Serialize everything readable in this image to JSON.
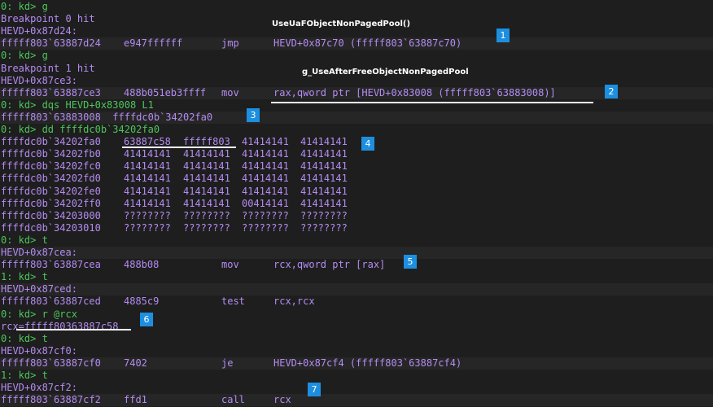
{
  "lines": [
    {
      "type": "prompt",
      "text": "0: kd> g"
    },
    {
      "type": "text",
      "text": "Breakpoint 0 hit"
    },
    {
      "type": "text",
      "text": "HEVD+0x87d24:"
    },
    {
      "type": "instr",
      "addr": "fffff803`63887d24",
      "bytes": "e947ffffff",
      "mnem": "jmp",
      "ops": "HEVD+0x87c70 (fffff803`63887c70)"
    },
    {
      "type": "prompt",
      "text": "0: kd> g"
    },
    {
      "type": "text",
      "text": "Breakpoint 1 hit"
    },
    {
      "type": "text",
      "text": "HEVD+0x87ce3:"
    },
    {
      "type": "instr",
      "addr": "fffff803`63887ce3",
      "bytes": "488b051eb3ffff",
      "mnem": "mov",
      "ops": "rax,qword ptr [HEVD+0x83008 (fffff803`63883008)]"
    },
    {
      "type": "prompt",
      "text": "0: kd> dqs HEVD+0x83008 L1"
    },
    {
      "type": "text",
      "text": "fffff803`63883008  ffffdc0b`34202fa0"
    },
    {
      "type": "prompt",
      "text": "0: kd> dd ffffdc0b`34202fa0"
    },
    {
      "type": "dump",
      "addr": "ffffdc0b`34202fa0",
      "d": [
        "63887c58",
        "fffff803",
        "41414141",
        "41414141"
      ]
    },
    {
      "type": "dump",
      "addr": "ffffdc0b`34202fb0",
      "d": [
        "41414141",
        "41414141",
        "41414141",
        "41414141"
      ]
    },
    {
      "type": "dump",
      "addr": "ffffdc0b`34202fc0",
      "d": [
        "41414141",
        "41414141",
        "41414141",
        "41414141"
      ]
    },
    {
      "type": "dump",
      "addr": "ffffdc0b`34202fd0",
      "d": [
        "41414141",
        "41414141",
        "41414141",
        "41414141"
      ]
    },
    {
      "type": "dump",
      "addr": "ffffdc0b`34202fe0",
      "d": [
        "41414141",
        "41414141",
        "41414141",
        "41414141"
      ]
    },
    {
      "type": "dump",
      "addr": "ffffdc0b`34202ff0",
      "d": [
        "41414141",
        "41414141",
        "00414141",
        "41414141"
      ]
    },
    {
      "type": "dump",
      "addr": "ffffdc0b`34203000",
      "d": [
        "????????",
        "????????",
        "????????",
        "????????"
      ]
    },
    {
      "type": "dump",
      "addr": "ffffdc0b`34203010",
      "d": [
        "????????",
        "????????",
        "????????",
        "????????"
      ]
    },
    {
      "type": "prompt",
      "text": "0: kd> t"
    },
    {
      "type": "text",
      "text": "HEVD+0x87cea:"
    },
    {
      "type": "instr",
      "addr": "fffff803`63887cea",
      "bytes": "488b08",
      "mnem": "mov",
      "ops": "rcx,qword ptr [rax]"
    },
    {
      "type": "prompt",
      "text": "1: kd> t"
    },
    {
      "type": "text",
      "text": "HEVD+0x87ced:"
    },
    {
      "type": "instr",
      "addr": "fffff803`63887ced",
      "bytes": "4885c9",
      "mnem": "test",
      "ops": "rcx,rcx"
    },
    {
      "type": "prompt",
      "text": "0: kd> r @rcx"
    },
    {
      "type": "text",
      "text": "rcx=fffff80363887c58"
    },
    {
      "type": "prompt",
      "text": "0: kd> t"
    },
    {
      "type": "text",
      "text": "HEVD+0x87cf0:"
    },
    {
      "type": "instr",
      "addr": "fffff803`63887cf0",
      "bytes": "7402",
      "mnem": "je",
      "ops": "HEVD+0x87cf4 (fffff803`63887cf4)"
    },
    {
      "type": "prompt",
      "text": "1: kd> t"
    },
    {
      "type": "text",
      "text": "HEVD+0x87cf2:"
    },
    {
      "type": "instr",
      "addr": "fffff803`63887cf2",
      "bytes": "ffd1",
      "mnem": "call",
      "ops": "rcx"
    }
  ],
  "annotations": {
    "label_1": "UseUaFObjectNonPagedPool()",
    "label_2": "g_UseAfterFreeObjectNonPagedPool",
    "badges": [
      "1",
      "2",
      "3",
      "4",
      "5",
      "6",
      "7"
    ]
  },
  "colors": {
    "background": "#1e1e1e",
    "output_text": "#b48cf2",
    "prompt_text": "#4cc75a",
    "badge": "#1d8fe0"
  }
}
